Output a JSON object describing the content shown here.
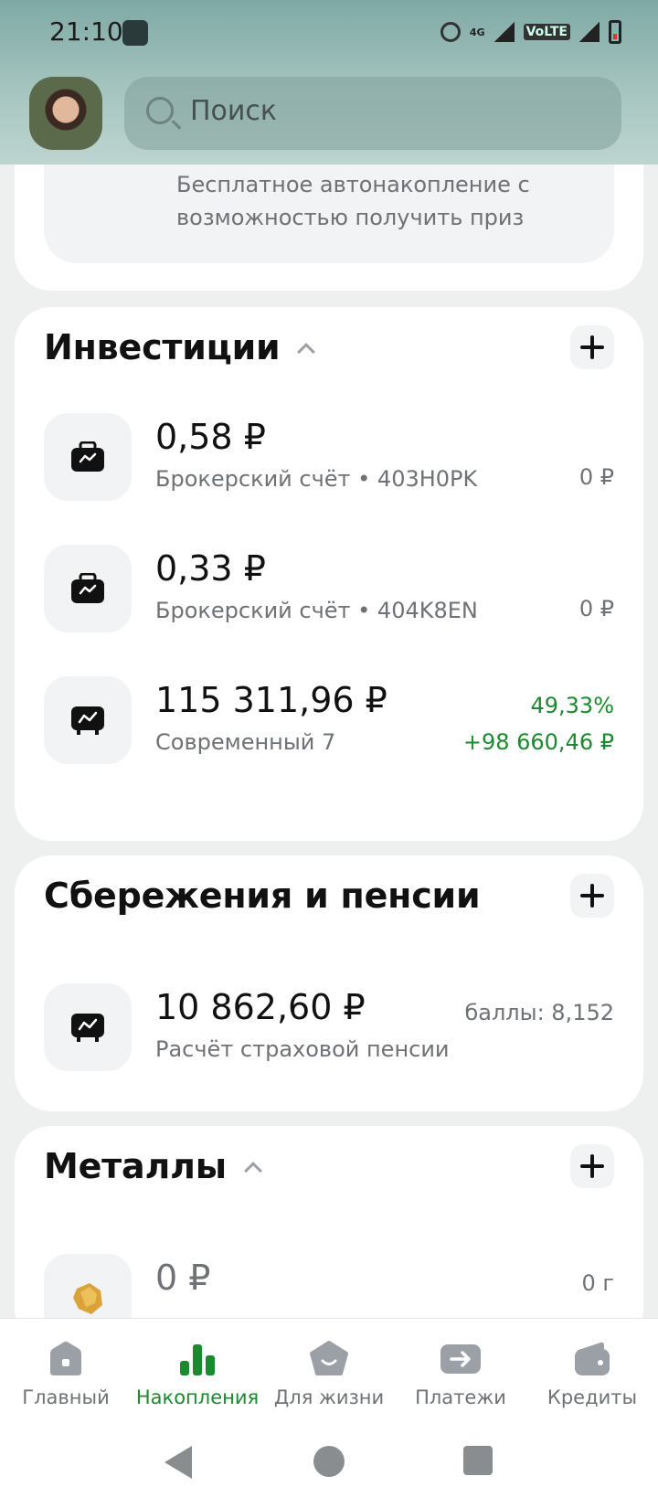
{
  "status_bar": {
    "time": "21:10",
    "network": "4G",
    "volte": "VoLTE"
  },
  "search": {
    "placeholder": "Поиск"
  },
  "promo": {
    "text": "Бесплатное автонакопление с возможностью получить приз"
  },
  "investments": {
    "title": "Инвестиции",
    "items": [
      {
        "amount": "0,58 ₽",
        "subtitle": "Брокерский счёт • 403H0PK",
        "right": "0 ₽",
        "icon": "briefcase-icon"
      },
      {
        "amount": "0,33 ₽",
        "subtitle": "Брокерский счёт • 404K8EN",
        "right": "0 ₽",
        "icon": "briefcase-icon"
      },
      {
        "amount": "115 311,96 ₽",
        "subtitle": "Современный 7",
        "percent": "49,33%",
        "gain": "+98 660,46 ₽",
        "icon": "chart-case-icon"
      }
    ]
  },
  "savings": {
    "title": "Сбережения и пенсии",
    "items": [
      {
        "amount": "10 862,60 ₽",
        "subtitle": "Расчёт страховой пенсии",
        "right": "баллы: 8,152",
        "icon": "chart-case-icon"
      }
    ]
  },
  "metals": {
    "title": "Металлы",
    "items": [
      {
        "amount": "0 ₽",
        "right": "0 г",
        "icon": "gold-nugget-icon"
      }
    ]
  },
  "bottom_nav": [
    {
      "label": "Главный",
      "icon": "home-icon",
      "active": false
    },
    {
      "label": "Накопления",
      "icon": "bar-chart-icon",
      "active": true
    },
    {
      "label": "Для жизни",
      "icon": "smile-star-icon",
      "active": false
    },
    {
      "label": "Платежи",
      "icon": "transfer-arrow-icon",
      "active": false
    },
    {
      "label": "Кредиты",
      "icon": "wallet-icon",
      "active": false
    }
  ],
  "colors": {
    "accent": "#21a038",
    "positive": "#1b8a2f",
    "header": "#a9c7c2"
  }
}
